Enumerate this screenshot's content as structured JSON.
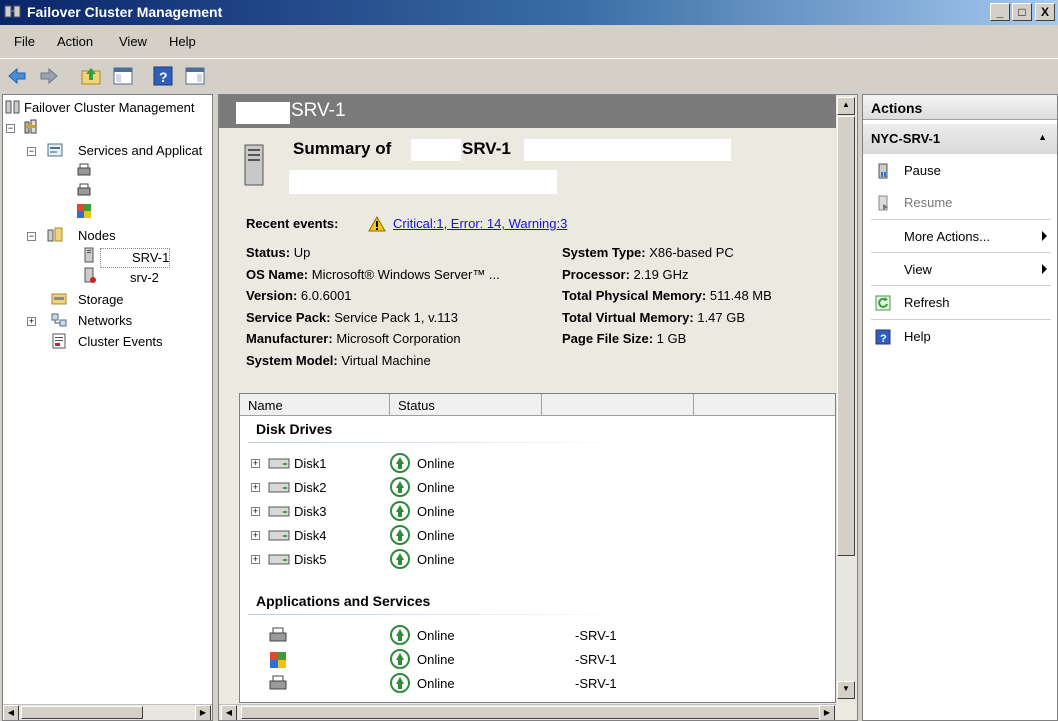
{
  "window": {
    "title": "Failover Cluster Management",
    "min": "_",
    "max": "□",
    "close": "X"
  },
  "menu": [
    "File",
    "Action",
    "View",
    "Help"
  ],
  "tree": {
    "root": "Failover Cluster Management",
    "services": "Services and Applicat",
    "nodes": "Nodes",
    "node1": "SRV-1",
    "node2": "srv-2",
    "storage": "Storage",
    "networks": "Networks",
    "events": "Cluster Events"
  },
  "center": {
    "header": "SRV-1",
    "summary_prefix": "Summary of",
    "summary_node": "SRV-1",
    "recent_events_label": "Recent events:",
    "recent_events_value": "Critical:1, Error: 14, Warning:3",
    "left_fields": [
      {
        "label": "Status:",
        "value": "Up"
      },
      {
        "label": "OS Name:",
        "value": "Microsoft® Windows Server™ ..."
      },
      {
        "label": "Version:",
        "value": "6.0.6001"
      },
      {
        "label": "Service Pack:",
        "value": "Service Pack 1, v.113"
      },
      {
        "label": "Manufacturer:",
        "value": "Microsoft Corporation"
      },
      {
        "label": "System Model:",
        "value": "Virtual Machine"
      }
    ],
    "right_fields": [
      {
        "label": "System Type:",
        "value": "X86-based PC"
      },
      {
        "label": "Processor:",
        "value": "2.19 GHz"
      },
      {
        "label": "Total Physical Memory:",
        "value": "511.48 MB"
      },
      {
        "label": "Total Virtual Memory:",
        "value": "1.47 GB"
      },
      {
        "label": "Page File Size:",
        "value": "1 GB"
      }
    ],
    "columns": [
      "Name",
      "Status"
    ],
    "disk_group": "Disk Drives",
    "disks": [
      {
        "name": "Disk1",
        "status": "Online"
      },
      {
        "name": "Disk2",
        "status": "Online"
      },
      {
        "name": "Disk3",
        "status": "Online"
      },
      {
        "name": "Disk4",
        "status": "Online"
      },
      {
        "name": "Disk5",
        "status": "Online"
      }
    ],
    "apps_group": "Applications and Services",
    "apps": [
      {
        "status": "Online",
        "owner": "-SRV-1"
      },
      {
        "status": "Online",
        "owner": "-SRV-1"
      },
      {
        "status": "Online",
        "owner": "-SRV-1"
      }
    ]
  },
  "actions": {
    "header": "Actions",
    "node": "NYC-SRV-1",
    "items": [
      "Pause",
      "Resume",
      "More Actions...",
      "View",
      "Refresh",
      "Help"
    ]
  },
  "colors": {
    "title_start": "#0a246a",
    "link": "#1414c8",
    "online_green": "#2e8b3c"
  }
}
